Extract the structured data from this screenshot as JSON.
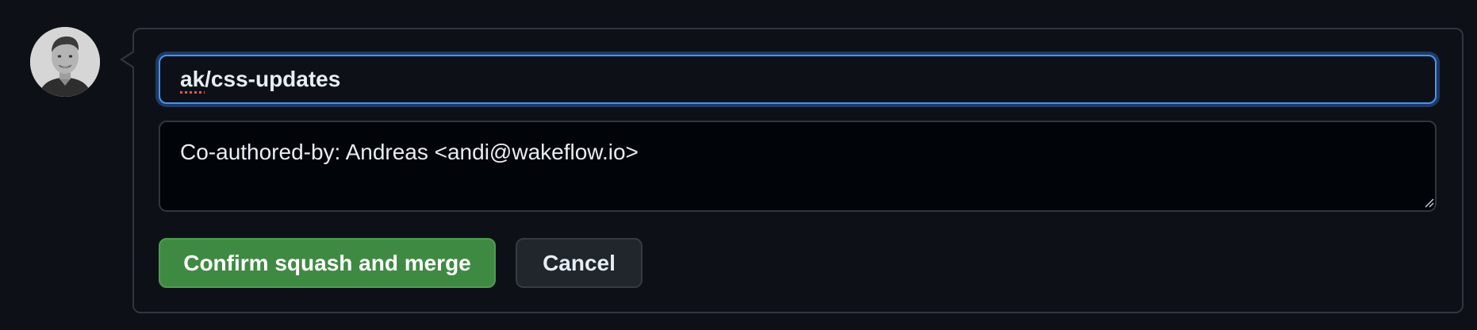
{
  "commit": {
    "title_prefix": "ak",
    "title_rest": "/css-updates",
    "message": "Co-authored-by: Andreas <andi@wakeflow.io>"
  },
  "actions": {
    "confirm_label": "Confirm squash and merge",
    "cancel_label": "Cancel"
  },
  "icons": {
    "avatar": "user-avatar",
    "resize": "resize-grip-icon"
  },
  "colors": {
    "background": "#0d1117",
    "focus_border": "#4493f8",
    "primary_button": "#3f8a42",
    "secondary_button": "#21262d",
    "text": "#e6edf3"
  }
}
